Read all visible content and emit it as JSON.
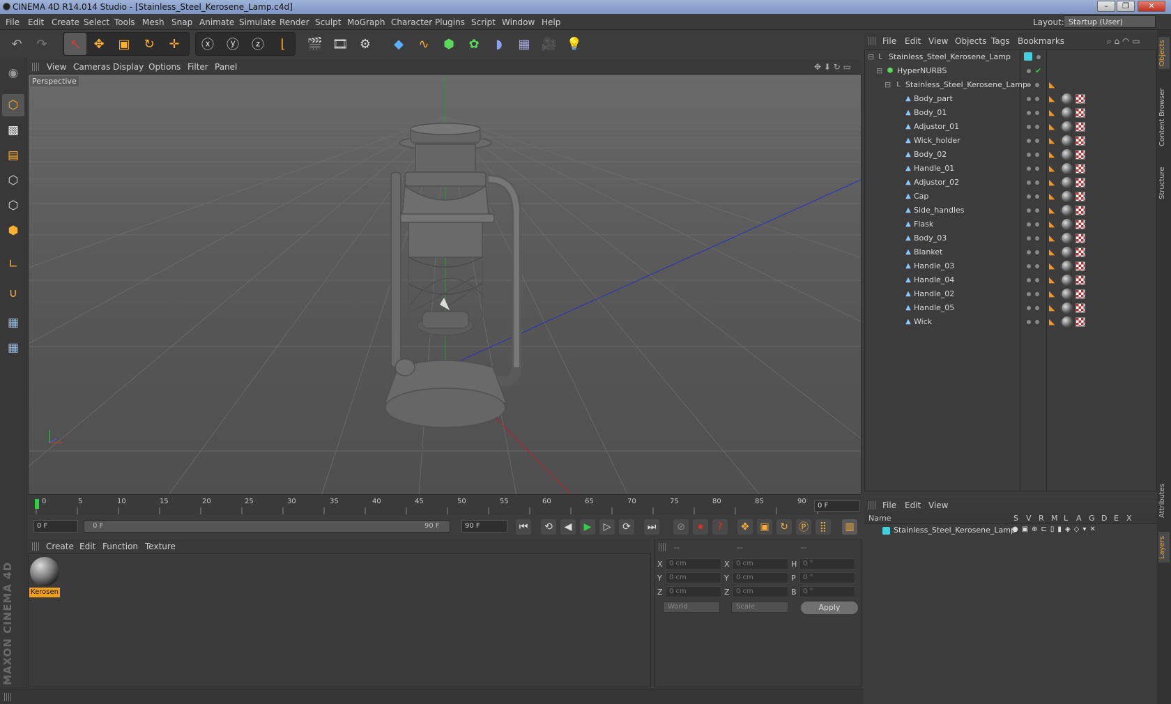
{
  "window": {
    "title": "CINEMA 4D R14.014 Studio - [Stainless_Steel_Kerosene_Lamp.c4d]",
    "buttons": [
      "–",
      "❐",
      "✕"
    ]
  },
  "menubar": {
    "items": [
      "File",
      "Edit",
      "Create",
      "Select",
      "Tools",
      "Mesh",
      "Snap",
      "Animate",
      "Simulate",
      "Render",
      "Sculpt",
      "MoGraph",
      "Character",
      "Plugins",
      "Script",
      "Window",
      "Help"
    ],
    "layout_label": "Layout:",
    "layout_value": "Startup (User)"
  },
  "viewport": {
    "menu": [
      "View",
      "Cameras",
      "Display",
      "Options",
      "Filter",
      "Panel"
    ],
    "label": "Perspective"
  },
  "timeline": {
    "ticks": [
      "0",
      "5",
      "10",
      "15",
      "20",
      "25",
      "30",
      "35",
      "40",
      "45",
      "50",
      "55",
      "60",
      "65",
      "70",
      "75",
      "80",
      "85",
      "90"
    ],
    "current_frame": "0 F"
  },
  "playbar": {
    "start": "0 F",
    "range_start": "0 F",
    "range_end": "90 F",
    "end": "90 F"
  },
  "material_manager": {
    "menu": [
      "Create",
      "Edit",
      "Function",
      "Texture"
    ],
    "materials": [
      {
        "name": "Kerosen"
      }
    ]
  },
  "coordinates": {
    "headers": [
      "--",
      "--",
      "--"
    ],
    "rows": [
      {
        "a": "X",
        "av": "0 cm",
        "b": "X",
        "bv": "0 cm",
        "c": "H",
        "cv": "0 °"
      },
      {
        "a": "Y",
        "av": "0 cm",
        "b": "Y",
        "bv": "0 cm",
        "c": "P",
        "cv": "0 °"
      },
      {
        "a": "Z",
        "av": "0 cm",
        "b": "Z",
        "bv": "0 cm",
        "c": "B",
        "cv": "0 °"
      }
    ],
    "mode": "World",
    "scale": "Scale",
    "apply": "Apply"
  },
  "object_manager": {
    "menu": [
      "File",
      "Edit",
      "View",
      "Objects",
      "Tags",
      "Bookmarks"
    ],
    "root": "Stainless_Steel_Kerosene_Lamp",
    "nurbs": "HyperNURBS",
    "group": "Stainless_Steel_Kerosene_Lamp",
    "children": [
      "Body_part",
      "Body_01",
      "Adjustor_01",
      "Wick_holder",
      "Body_02",
      "Handle_01",
      "Adjustor_02",
      "Cap",
      "Side_handles",
      "Flask",
      "Body_03",
      "Blanket",
      "Handle_03",
      "Handle_04",
      "Handle_02",
      "Handle_05",
      "Wick"
    ]
  },
  "layers": {
    "menu": [
      "File",
      "Edit",
      "View"
    ],
    "columns": [
      "Name",
      "S",
      "V",
      "R",
      "M",
      "L",
      "A",
      "G",
      "D",
      "E",
      "X"
    ],
    "items": [
      "Stainless_Steel_Kerosene_Lamp"
    ]
  },
  "right_tabs": [
    "Objects",
    "Content Browser",
    "Structure",
    "Attributes",
    "Layers"
  ],
  "colors": {
    "accent": "#f0a020",
    "layer": "#40d0e0",
    "bg": "#3c3c3c"
  }
}
